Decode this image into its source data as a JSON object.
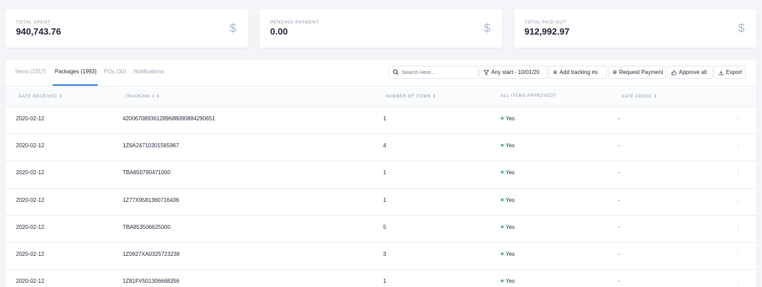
{
  "summary_cards": [
    {
      "label": "TOTAL SPENT",
      "value": "940,743.76",
      "icon": "dollar-icon"
    },
    {
      "label": "PENDING PAYMENT",
      "value": "0.00",
      "icon": "dollar-icon"
    },
    {
      "label": "TOTAL PAID OUT",
      "value": "912,992.97",
      "icon": "dollar-icon"
    }
  ],
  "tabs": [
    {
      "label": "Items (2317)",
      "active": false
    },
    {
      "label": "Packages (1993)",
      "active": true
    },
    {
      "label": "POs (30)",
      "active": false
    },
    {
      "label": "Notifications",
      "active": false
    }
  ],
  "toolbar": {
    "search_placeholder": "Search Here...",
    "date_filter_label": "Any start - 10/01/20",
    "add_tracking_label": "Add tracking #s",
    "request_payment_label": "Request Payment",
    "approve_all_label": "Approve all",
    "export_label": "Export"
  },
  "table": {
    "columns": [
      {
        "label": "DATE RECEIVED",
        "sortable": true
      },
      {
        "label": "TRACKING #",
        "sortable": true
      },
      {
        "label": "NUMBER OF ITEMS",
        "sortable": true
      },
      {
        "label": "ALL ITEMS APPROVED?",
        "sortable": false
      },
      {
        "label": "DATE ADDED",
        "sortable": true
      }
    ],
    "rows": [
      {
        "date_received": "2020-02-12",
        "tracking": "420067089361289688090884290651",
        "items": "1",
        "approved": "Yes",
        "date_added": "-"
      },
      {
        "date_received": "2020-02-12",
        "tracking": "1Z6A24710301565967",
        "items": "4",
        "approved": "Yes",
        "date_added": "-"
      },
      {
        "date_received": "2020-02-12",
        "tracking": "TBA850790471000",
        "items": "1",
        "approved": "Yes",
        "date_added": "-"
      },
      {
        "date_received": "2020-02-12",
        "tracking": "1Z77X9581360716436",
        "items": "1",
        "approved": "Yes",
        "date_added": "-"
      },
      {
        "date_received": "2020-02-12",
        "tracking": "TBA853506625000",
        "items": "5",
        "approved": "Yes",
        "date_added": "-"
      },
      {
        "date_received": "2020-02-12",
        "tracking": "1Z0927XA0325723238",
        "items": "3",
        "approved": "Yes",
        "date_added": "-"
      },
      {
        "date_received": "2020-02-12",
        "tracking": "1Z81FV501306668356",
        "items": "1",
        "approved": "Yes",
        "date_added": "-"
      }
    ]
  },
  "colors": {
    "accent": "#2f7fd6",
    "approved_dot": "#2ecc71"
  }
}
